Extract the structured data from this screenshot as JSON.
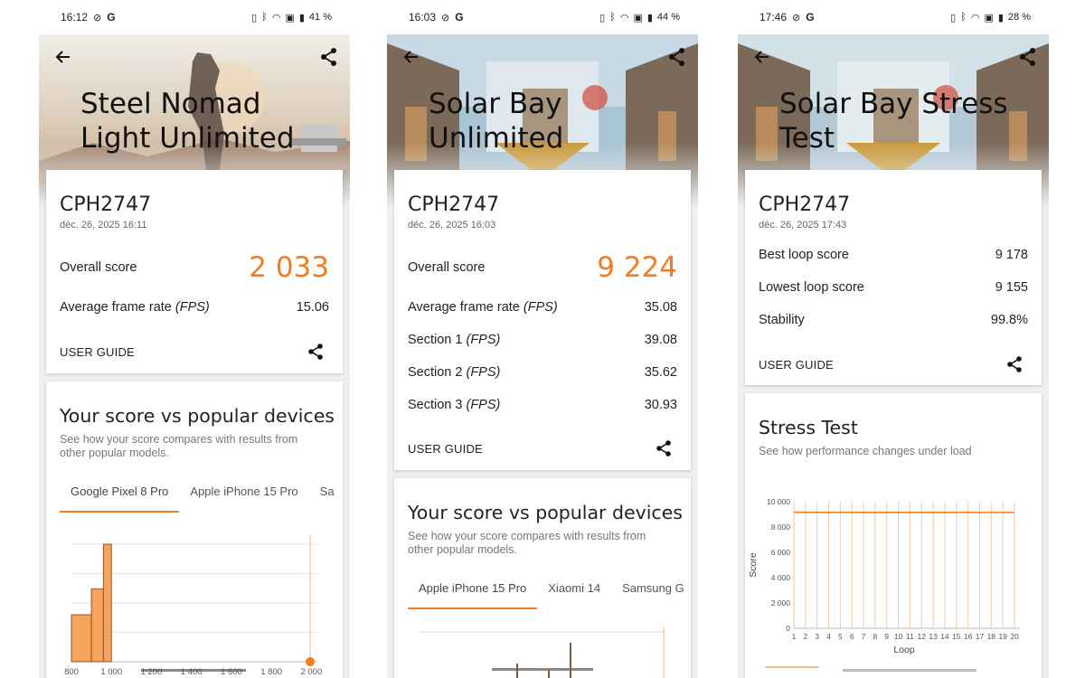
{
  "phones": [
    {
      "status": {
        "time": "16:12",
        "battery": "41 %"
      },
      "hero": {
        "title": "Steel Nomad Light Unlimited"
      },
      "result": {
        "device": "CPH2747",
        "date": "déc. 26, 2025 16:11",
        "overall_label": "Overall score",
        "overall_value": "2 033",
        "fps_label": "Average frame rate",
        "fps_unit": "(FPS)",
        "fps_value": "15.06",
        "user_guide": "USER GUIDE"
      },
      "compare": {
        "title": "Your score vs popular devices",
        "subtitle": "See how your score compares with results from other popular models.",
        "tabs": [
          "Google Pixel 8 Pro",
          "Apple iPhone 15 Pro",
          "Sa"
        ],
        "active_tab": 0
      },
      "chart_data": {
        "type": "bar",
        "x_ticks": [
          "800",
          "1 000",
          "1 200",
          "1 400",
          "1 600",
          "1 800",
          "2 000"
        ],
        "bins": [
          {
            "from": 800,
            "to": 900,
            "value": 0.4
          },
          {
            "from": 900,
            "to": 960,
            "value": 0.62
          },
          {
            "from": 960,
            "to": 1000,
            "value": 1.0
          }
        ],
        "marker_x": 2033,
        "xlim": [
          800,
          2030
        ]
      }
    },
    {
      "status": {
        "time": "16:03",
        "battery": "44 %"
      },
      "hero": {
        "title": "Solar Bay Unlimited"
      },
      "result": {
        "device": "CPH2747",
        "date": "déc. 26, 2025 16:03",
        "overall_label": "Overall score",
        "overall_value": "9 224",
        "fps_label": "Average frame rate",
        "fps_unit": "(FPS)",
        "fps_value": "35.08",
        "sections": [
          {
            "label": "Section 1",
            "unit": "(FPS)",
            "value": "39.08"
          },
          {
            "label": "Section 2",
            "unit": "(FPS)",
            "value": "35.62"
          },
          {
            "label": "Section 3",
            "unit": "(FPS)",
            "value": "30.93"
          }
        ],
        "user_guide": "USER GUIDE"
      },
      "compare": {
        "title": "Your score vs popular devices",
        "subtitle": "See how your score compares with results from other popular models.",
        "tabs": [
          "Apple iPhone 15 Pro",
          "Xiaomi 14",
          "Samsung G"
        ],
        "active_tab": 0
      }
    },
    {
      "status": {
        "time": "17:46",
        "battery": "28 %"
      },
      "hero": {
        "title": "Solar Bay Stress Test"
      },
      "result": {
        "device": "CPH2747",
        "date": "déc. 26, 2025 17:43",
        "rows": [
          {
            "label": "Best loop score",
            "value": "9 178"
          },
          {
            "label": "Lowest loop score",
            "value": "9 155"
          },
          {
            "label": "Stability",
            "value": "99.8%"
          }
        ],
        "user_guide": "USER GUIDE"
      },
      "stress": {
        "title": "Stress Test",
        "subtitle": "See how performance changes under load"
      },
      "chart_data": {
        "type": "line",
        "xlabel": "Loop",
        "ylabel": "Score",
        "ylim": [
          0,
          10000
        ],
        "y_ticks": [
          "0",
          "2 000",
          "4 000",
          "6 000",
          "8 000",
          "10 000"
        ],
        "x": [
          1,
          2,
          3,
          4,
          5,
          6,
          7,
          8,
          9,
          10,
          11,
          12,
          13,
          14,
          15,
          16,
          17,
          18,
          19,
          20
        ],
        "values": [
          9178,
          9170,
          9168,
          9165,
          9166,
          9163,
          9162,
          9160,
          9161,
          9159,
          9160,
          9158,
          9157,
          9158,
          9156,
          9157,
          9155,
          9156,
          9155,
          9156
        ]
      }
    }
  ],
  "colors": {
    "accent": "#f47b20",
    "bar": "#f7a35c"
  }
}
